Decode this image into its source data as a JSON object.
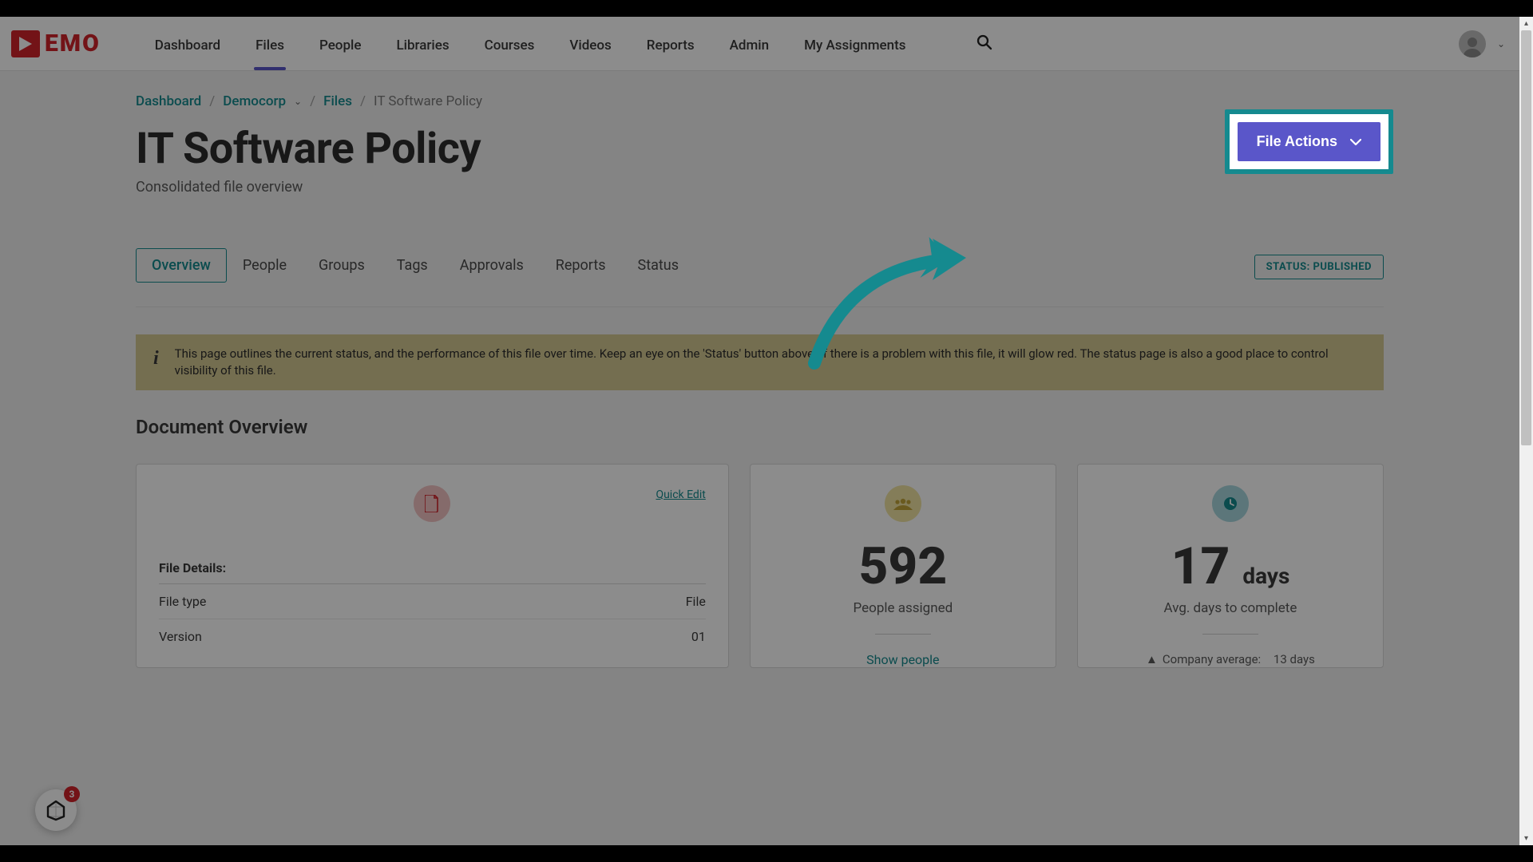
{
  "logo_text": "EMO",
  "nav": {
    "items": [
      "Dashboard",
      "Files",
      "People",
      "Libraries",
      "Courses",
      "Videos",
      "Reports",
      "Admin",
      "My Assignments"
    ],
    "active_index": 1
  },
  "breadcrumb": {
    "items": [
      {
        "label": "Dashboard",
        "link": true,
        "dropdown": false
      },
      {
        "label": "Democorp",
        "link": true,
        "dropdown": true
      },
      {
        "label": "Files",
        "link": true,
        "dropdown": false
      },
      {
        "label": "IT Software Policy",
        "link": false,
        "dropdown": false
      }
    ]
  },
  "page_title": "IT Software Policy",
  "page_subtitle": "Consolidated file overview",
  "file_actions_label": "File Actions",
  "tabs": [
    "Overview",
    "People",
    "Groups",
    "Tags",
    "Approvals",
    "Reports",
    "Status"
  ],
  "active_tab_index": 0,
  "status_badge": "STATUS: PUBLISHED",
  "info_banner": "This page outlines the current status, and the performance of this file over time. Keep an eye on the 'Status' button above. If there is a problem with this file, it will glow red. The status page is also a good place to control visibility of this file.",
  "section_title": "Document Overview",
  "document_card": {
    "quick_edit": "Quick Edit",
    "file_details_label": "File Details:",
    "rows": [
      {
        "label": "File type",
        "value": "File"
      },
      {
        "label": "Version",
        "value": "01"
      }
    ]
  },
  "people_card": {
    "number": "592",
    "label": "People assigned",
    "link": "Show people"
  },
  "days_card": {
    "number": "17",
    "unit": "days",
    "label": "Avg. days to complete",
    "foot_label": "Company average:",
    "foot_value": "13 days"
  },
  "chat_badge": "3"
}
